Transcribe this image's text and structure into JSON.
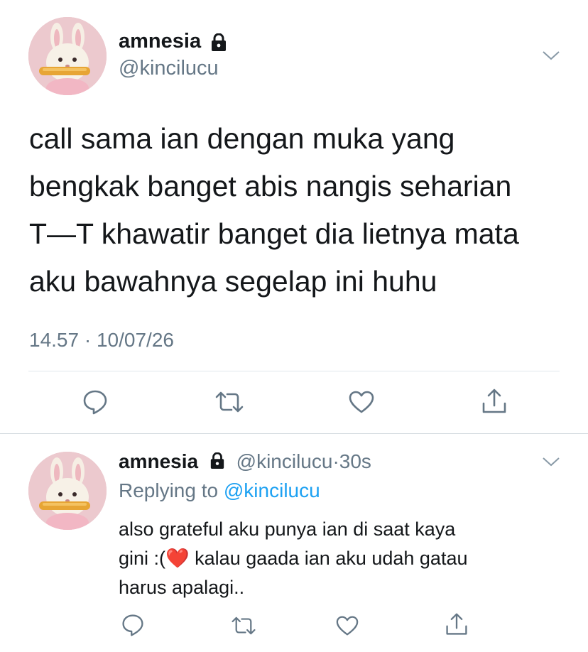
{
  "tweet": {
    "name": "amnesia",
    "handle": "@kincilucu",
    "lines": [
      "call sama ian dengan muka yang",
      "bengkak banget abis nangis seharian",
      "T—T khawatir banget dia lietnya mata",
      "aku bawahnya segelap ini huhu"
    ],
    "time": "14.57",
    "date": "10/07/26",
    "separator": "·"
  },
  "reply": {
    "name": "amnesia",
    "handle": "@kincilucu",
    "dot": "·",
    "age": "30s",
    "replying_prefix": "Replying to",
    "replying_handle": "@kincilucu",
    "line1": "also grateful aku punya ian di saat kaya",
    "line2_before": "gini :(",
    "heart_emoji": "❤️",
    "line2_after": " kalau gaada ian aku udah gatau",
    "line3": "harus apalagi.."
  },
  "colors": {
    "text": "#14171a",
    "secondary": "#657786",
    "link": "#1da1f2",
    "divider": "#e1e8ed",
    "heart": "#e0245e"
  },
  "icons": [
    "lock-icon",
    "chevron-down-icon",
    "reply-icon",
    "retweet-icon",
    "like-icon",
    "share-icon"
  ]
}
